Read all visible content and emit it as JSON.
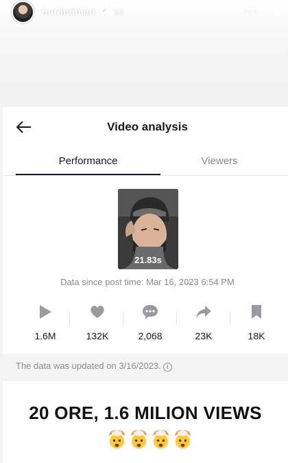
{
  "story": {
    "username": "butrintimeri",
    "time": "1h",
    "more_glyph": "···"
  },
  "card": {
    "title": "Video analysis",
    "tabs": [
      {
        "label": "Performance",
        "active": true
      },
      {
        "label": "Viewers",
        "active": false
      }
    ],
    "video": {
      "duration": "21.83s"
    },
    "post_time": "Data since post time: Mar 16, 2023 6:54 PM",
    "stats": [
      {
        "icon": "play-icon",
        "value": "1.6M"
      },
      {
        "icon": "heart-icon",
        "value": "132K"
      },
      {
        "icon": "comment-icon",
        "value": "2,068"
      },
      {
        "icon": "share-icon",
        "value": "23K"
      },
      {
        "icon": "bookmark-icon",
        "value": "18K"
      }
    ],
    "update_note": "The data was updated on 3/16/2023."
  },
  "caption": {
    "text": "20 ORE, 1.6 MILION VIEWS",
    "emoji_count": 4,
    "emoji_icon": "exploding-head-emoji"
  },
  "colors": {
    "text_primary": "#161823",
    "text_secondary": "#8a8b91",
    "icon_gray": "#9a9ba0",
    "background": "#f3f3f3"
  }
}
